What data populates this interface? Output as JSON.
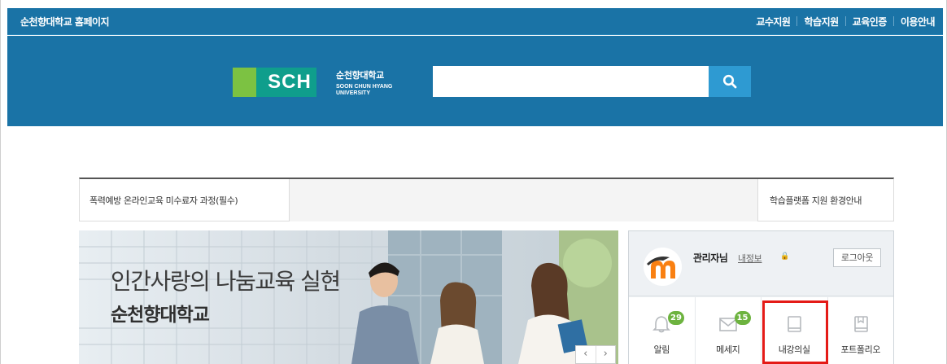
{
  "topbar": {
    "home_link": "순천향대학교 홈페이지",
    "nav": [
      "교수지원",
      "학습지원",
      "교육인증",
      "이용안내"
    ]
  },
  "header": {
    "logo_mark": "SCH",
    "logo_kr": "순천향대학교",
    "logo_en_line1": "SOON CHUN HYANG",
    "logo_en_line2": "UNIVERSITY",
    "search_value": "",
    "search_icon": "search-icon"
  },
  "notice": {
    "left": "폭력예방 온라인교육 미수료자 과정(필수)",
    "right": "학습플랫폼 지원 환경안내"
  },
  "banner": {
    "title": "인간사랑의 나눔교육 실현",
    "subtitle": "순천향대학교",
    "prev": "‹",
    "next": "›"
  },
  "user": {
    "name": "관리자님",
    "myinfo": "내정보",
    "logout": "로그아웃"
  },
  "quick": [
    {
      "label": "알림",
      "icon": "bell-icon",
      "badge": "29"
    },
    {
      "label": "메세지",
      "icon": "mail-icon",
      "badge": "15"
    },
    {
      "label": "내강의실",
      "icon": "book-icon",
      "badge": ""
    },
    {
      "label": "포트폴리오",
      "icon": "portfolio-icon",
      "badge": ""
    }
  ],
  "colors": {
    "brand_blue": "#1a73a6",
    "search_button": "#2e9ad2",
    "badge_green": "#6db33f",
    "highlight_red": "#e41b17"
  }
}
